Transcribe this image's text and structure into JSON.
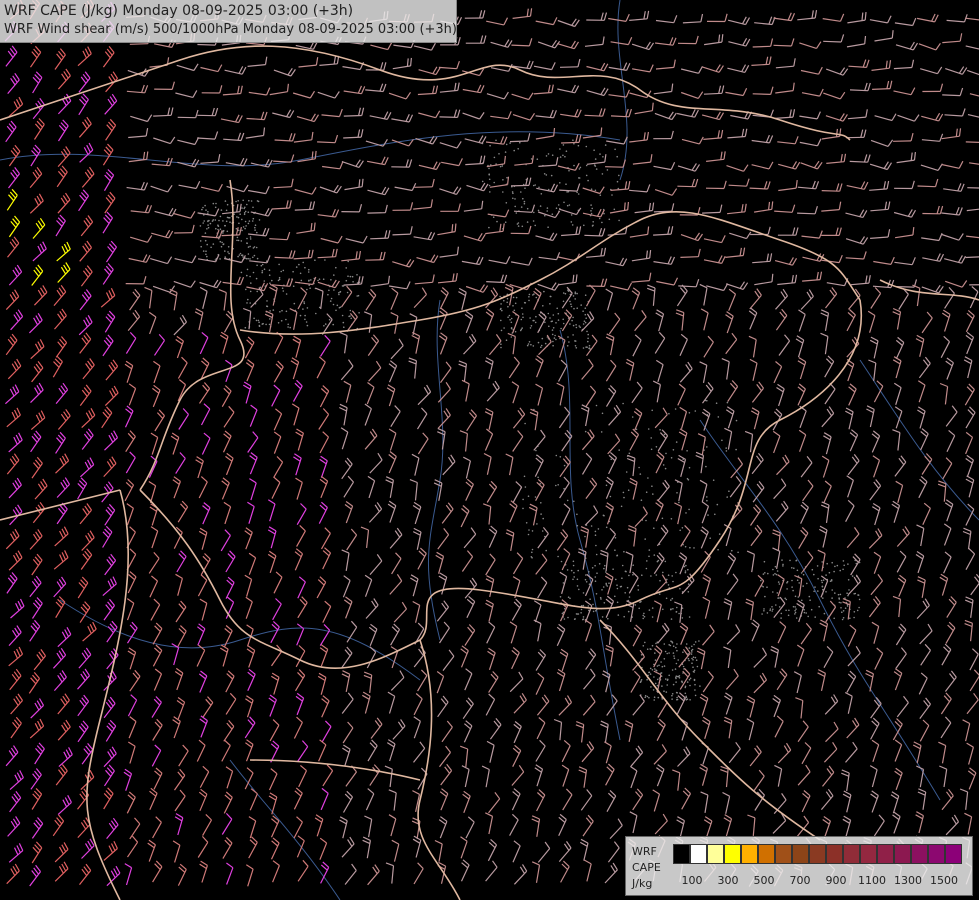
{
  "title": {
    "line1": "WRF CAPE (J/kg) Monday 08-09-2025 03:00 (+3h)",
    "line2": "WRF Wind shear (m/s) 500/1000hPa Monday 08-09-2025 03:00 (+3h)"
  },
  "legend": {
    "label1": "WRF",
    "label2": "CAPE",
    "label3": "J/kg",
    "colors": [
      "#000000",
      "#ffffff",
      "#ffff99",
      "#ffff00",
      "#ffb000",
      "#d07000",
      "#a05018",
      "#8c4418",
      "#8a3a22",
      "#8c3028",
      "#902c38",
      "#942840",
      "#902048",
      "#8c1850",
      "#8c1060",
      "#8c0870",
      "#8c0078"
    ],
    "ticks": [
      "100",
      "300",
      "500",
      "700",
      "900",
      "1100",
      "1300",
      "1500"
    ]
  },
  "map": {
    "background": "#000000",
    "barb_colors": [
      "#b89aa0",
      "#c08a8a",
      "#d07a78",
      "#e06060",
      "#e040e0",
      "#ffff00"
    ],
    "border_color": "#e0b8a0",
    "river_color": "#3a5a90"
  }
}
